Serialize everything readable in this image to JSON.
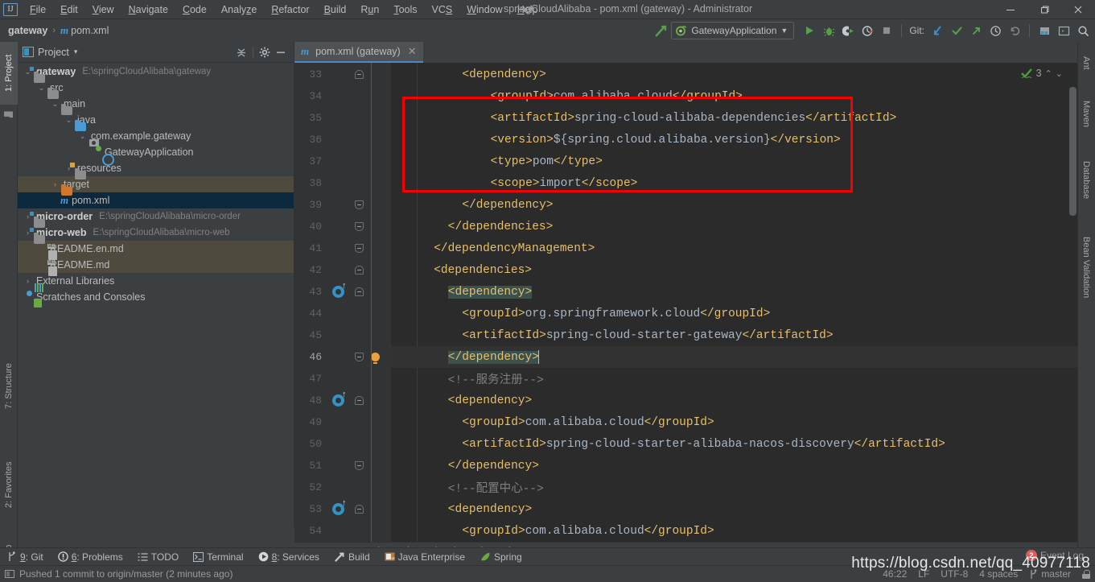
{
  "window": {
    "title": "springCloudAlibaba - pom.xml (gateway) - Administrator",
    "minimize": "—",
    "maximize": "❐",
    "close": "✕",
    "logo": "IJ"
  },
  "menu": {
    "items": [
      {
        "label": "File",
        "mnemonic": "F"
      },
      {
        "label": "Edit",
        "mnemonic": "E"
      },
      {
        "label": "View",
        "mnemonic": "V"
      },
      {
        "label": "Navigate",
        "mnemonic": "N"
      },
      {
        "label": "Code",
        "mnemonic": "C"
      },
      {
        "label": "Analyze",
        "mnemonic": "z"
      },
      {
        "label": "Refactor",
        "mnemonic": "R"
      },
      {
        "label": "Build",
        "mnemonic": "B"
      },
      {
        "label": "Run",
        "mnemonic": "u"
      },
      {
        "label": "Tools",
        "mnemonic": "T"
      },
      {
        "label": "VCS",
        "mnemonic": "S"
      },
      {
        "label": "Window",
        "mnemonic": "W"
      },
      {
        "label": "Help",
        "mnemonic": "H"
      }
    ]
  },
  "navbar": {
    "crumb_project": "gateway",
    "crumb_file": "pom.xml",
    "separator": "›",
    "maven_glyph": "m"
  },
  "toolbar": {
    "build_label": "build-hammer-icon",
    "run_config": "GatewayApplication",
    "run": "Run",
    "debug": "Debug",
    "run_coverage": "Run with Coverage",
    "profile": "Profile",
    "stop": "Stop",
    "git_label": "Git:",
    "update_project": "Update Project",
    "commit": "Commit",
    "push": "Push",
    "history": "History",
    "rollback": "Rollback",
    "search_everywhere": "Search Everywhere"
  },
  "left_tool_strip": [
    {
      "label": "1: Project",
      "mnemonic": "1",
      "active": true
    },
    {
      "label": "7: Structure",
      "mnemonic": "7",
      "active": false
    },
    {
      "label": "2: Favorites",
      "mnemonic": "2",
      "active": false
    },
    {
      "label": "Web",
      "mnemonic": "",
      "active": false
    }
  ],
  "right_tool_strip": [
    {
      "label": "Ant"
    },
    {
      "label": "Maven"
    },
    {
      "label": "Database"
    },
    {
      "label": "Bean Validation"
    }
  ],
  "project_panel": {
    "title": "Project",
    "dropdown": "▾",
    "collapse_all": "collapse-all-icon",
    "settings": "gear-icon",
    "hide": "hide-icon",
    "tree": [
      {
        "indent": 0,
        "arrow": "⌄",
        "icon": "module",
        "label": "gateway",
        "bold": true,
        "path": "E:\\springCloudAlibaba\\gateway",
        "state": "normal"
      },
      {
        "indent": 1,
        "arrow": "⌄",
        "icon": "folder",
        "label": "src",
        "bold": false,
        "path": "",
        "state": "normal"
      },
      {
        "indent": 2,
        "arrow": "⌄",
        "icon": "folder",
        "label": "main",
        "bold": false,
        "path": "",
        "state": "normal"
      },
      {
        "indent": 3,
        "arrow": "⌄",
        "icon": "source-folder",
        "label": "java",
        "bold": false,
        "path": "",
        "state": "normal"
      },
      {
        "indent": 4,
        "arrow": "⌄",
        "icon": "package",
        "label": "com.example.gateway",
        "bold": false,
        "path": "",
        "state": "normal"
      },
      {
        "indent": 5,
        "arrow": "",
        "icon": "spring-class",
        "label": "GatewayApplication",
        "bold": false,
        "path": "",
        "state": "normal"
      },
      {
        "indent": 3,
        "arrow": "›",
        "icon": "resources-folder",
        "label": "resources",
        "bold": false,
        "path": "",
        "state": "normal"
      },
      {
        "indent": 2,
        "arrow": "›",
        "icon": "target-folder",
        "label": "target",
        "bold": false,
        "path": "",
        "state": "highlighted"
      },
      {
        "indent": 2,
        "arrow": "",
        "icon": "maven-file",
        "label": "pom.xml",
        "bold": false,
        "path": "",
        "state": "selected"
      },
      {
        "indent": 0,
        "arrow": "›",
        "icon": "module",
        "label": "micro-order",
        "bold": true,
        "path": "E:\\springCloudAlibaba\\micro-order",
        "state": "normal"
      },
      {
        "indent": 0,
        "arrow": "›",
        "icon": "module",
        "label": "micro-web",
        "bold": true,
        "path": "E:\\springCloudAlibaba\\micro-web",
        "state": "normal"
      },
      {
        "indent": 1,
        "arrow": "",
        "icon": "markdown",
        "label": "README.en.md",
        "bold": false,
        "path": "",
        "state": "highlighted"
      },
      {
        "indent": 1,
        "arrow": "",
        "icon": "markdown",
        "label": "README.md",
        "bold": false,
        "path": "",
        "state": "highlighted"
      },
      {
        "indent": 0,
        "arrow": "›",
        "icon": "library",
        "label": "External Libraries",
        "bold": false,
        "path": "",
        "state": "normal"
      },
      {
        "indent": 0,
        "arrow": "",
        "icon": "scratch",
        "label": "Scratches and Consoles",
        "bold": false,
        "path": "",
        "state": "normal"
      }
    ]
  },
  "editor": {
    "tab": {
      "label": "pom.xml (gateway)",
      "close": "✕",
      "icon": "maven-file-icon"
    },
    "inspection": {
      "status_icon": "green-check",
      "count": "3",
      "prev": "⌃",
      "next": "⌄"
    },
    "breadcrumb": [
      "project",
      "dependencies",
      "dependency"
    ],
    "breadcrumb_sep": "›",
    "first_line": 33,
    "lines": [
      {
        "n": 33,
        "indent": 8,
        "gutter": "fold-start",
        "current": false,
        "spans": [
          {
            "t": "tag",
            "v": "<dependency>"
          }
        ]
      },
      {
        "n": 34,
        "indent": 12,
        "gutter": "",
        "current": false,
        "spans": [
          {
            "t": "tag",
            "v": "<groupId>"
          },
          {
            "t": "txt",
            "v": "com.alibaba.cloud"
          },
          {
            "t": "tag",
            "v": "</groupId>"
          }
        ]
      },
      {
        "n": 35,
        "indent": 12,
        "gutter": "",
        "current": false,
        "spans": [
          {
            "t": "tag",
            "v": "<artifactId>"
          },
          {
            "t": "txt",
            "v": "spring-cloud-alibaba-dependencies"
          },
          {
            "t": "tag",
            "v": "</artifactId>"
          }
        ]
      },
      {
        "n": 36,
        "indent": 12,
        "gutter": "",
        "current": false,
        "spans": [
          {
            "t": "tag",
            "v": "<version>"
          },
          {
            "t": "txt",
            "v": "${spring.cloud.alibaba.version}"
          },
          {
            "t": "tag",
            "v": "</version>"
          }
        ]
      },
      {
        "n": 37,
        "indent": 12,
        "gutter": "",
        "current": false,
        "spans": [
          {
            "t": "tag",
            "v": "<type>"
          },
          {
            "t": "txt",
            "v": "pom"
          },
          {
            "t": "tag",
            "v": "</type>"
          }
        ]
      },
      {
        "n": 38,
        "indent": 12,
        "gutter": "",
        "current": false,
        "spans": [
          {
            "t": "tag",
            "v": "<scope>"
          },
          {
            "t": "txt",
            "v": "import"
          },
          {
            "t": "tag",
            "v": "</scope>"
          }
        ]
      },
      {
        "n": 39,
        "indent": 8,
        "gutter": "fold-end",
        "current": false,
        "spans": [
          {
            "t": "tag",
            "v": "</dependency>"
          }
        ]
      },
      {
        "n": 40,
        "indent": 6,
        "gutter": "fold-end",
        "current": false,
        "spans": [
          {
            "t": "tag",
            "v": "</dependencies>"
          }
        ]
      },
      {
        "n": 41,
        "indent": 4,
        "gutter": "fold-end",
        "current": false,
        "spans": [
          {
            "t": "tag",
            "v": "</dependencyManagement>"
          }
        ]
      },
      {
        "n": 42,
        "indent": 4,
        "gutter": "fold-start",
        "current": false,
        "spans": [
          {
            "t": "tag",
            "v": "<dependencies>"
          }
        ]
      },
      {
        "n": 43,
        "indent": 6,
        "gutter": "maven-fold-start",
        "current": false,
        "spans": [
          {
            "t": "tag hl",
            "v": "<dependency>"
          }
        ]
      },
      {
        "n": 44,
        "indent": 8,
        "gutter": "",
        "current": false,
        "spans": [
          {
            "t": "tag",
            "v": "<groupId>"
          },
          {
            "t": "txt",
            "v": "org.springframework.cloud"
          },
          {
            "t": "tag",
            "v": "</groupId>"
          }
        ]
      },
      {
        "n": 45,
        "indent": 8,
        "gutter": "",
        "current": false,
        "spans": [
          {
            "t": "tag",
            "v": "<artifactId>"
          },
          {
            "t": "txt",
            "v": "spring-cloud-starter-gateway"
          },
          {
            "t": "tag",
            "v": "</artifactId>"
          }
        ]
      },
      {
        "n": 46,
        "indent": 6,
        "gutter": "bulb-fold-end",
        "current": true,
        "spans": [
          {
            "t": "tag hl",
            "v": "</dependency>"
          },
          {
            "t": "caret",
            "v": ""
          }
        ]
      },
      {
        "n": 47,
        "indent": 6,
        "gutter": "",
        "current": false,
        "spans": [
          {
            "t": "cmt",
            "v": "<!--服务注册-->"
          }
        ]
      },
      {
        "n": 48,
        "indent": 6,
        "gutter": "maven-fold-start",
        "current": false,
        "spans": [
          {
            "t": "tag",
            "v": "<dependency>"
          }
        ]
      },
      {
        "n": 49,
        "indent": 8,
        "gutter": "",
        "current": false,
        "spans": [
          {
            "t": "tag",
            "v": "<groupId>"
          },
          {
            "t": "txt",
            "v": "com.alibaba.cloud"
          },
          {
            "t": "tag",
            "v": "</groupId>"
          }
        ]
      },
      {
        "n": 50,
        "indent": 8,
        "gutter": "",
        "current": false,
        "spans": [
          {
            "t": "tag",
            "v": "<artifactId>"
          },
          {
            "t": "txt",
            "v": "spring-cloud-starter-alibaba-nacos-discovery"
          },
          {
            "t": "tag",
            "v": "</artifactId>"
          }
        ]
      },
      {
        "n": 51,
        "indent": 6,
        "gutter": "fold-end",
        "current": false,
        "spans": [
          {
            "t": "tag",
            "v": "</dependency>"
          }
        ]
      },
      {
        "n": 52,
        "indent": 6,
        "gutter": "",
        "current": false,
        "spans": [
          {
            "t": "cmt",
            "v": "<!--配置中心-->"
          }
        ]
      },
      {
        "n": 53,
        "indent": 6,
        "gutter": "maven-fold-start",
        "current": false,
        "spans": [
          {
            "t": "tag",
            "v": "<dependency>"
          }
        ]
      },
      {
        "n": 54,
        "indent": 8,
        "gutter": "",
        "current": false,
        "spans": [
          {
            "t": "tag",
            "v": "<groupId>"
          },
          {
            "t": "txt",
            "v": "com.alibaba.cloud"
          },
          {
            "t": "tag",
            "v": "</groupId>"
          }
        ]
      }
    ]
  },
  "bottom_tools": [
    {
      "label": "9: Git",
      "mnemonic": "9",
      "icon": "git-branch-icon"
    },
    {
      "label": "6: Problems",
      "mnemonic": "6",
      "icon": "problems-icon"
    },
    {
      "label": "TODO",
      "mnemonic": "",
      "icon": "todo-list-icon"
    },
    {
      "label": "Terminal",
      "mnemonic": "",
      "icon": "terminal-icon"
    },
    {
      "label": "8: Services",
      "mnemonic": "8",
      "icon": "services-play-icon"
    },
    {
      "label": "Build",
      "mnemonic": "",
      "icon": "build-hammer-icon"
    },
    {
      "label": "Java Enterprise",
      "mnemonic": "",
      "icon": "java-enterprise-icon"
    },
    {
      "label": "Spring",
      "mnemonic": "",
      "icon": "spring-leaf-icon"
    }
  ],
  "status_bar": {
    "message": "Pushed 1 commit to origin/master (2 minutes ago)",
    "message_icon": "console-icon",
    "caret_position": "46:22",
    "line_separator": "LF",
    "encoding": "UTF-8",
    "indent": "4 spaces",
    "branch": "master",
    "branch_icon": "git-branch-icon",
    "lock": "lock-icon"
  },
  "event_log": {
    "label": "Event Log",
    "badge": "2"
  },
  "watermark": "https://blog.csdn.net/qq_40977118",
  "colors": {
    "bg_chrome": "#3c3f41",
    "bg_editor": "#2b2b2b",
    "bg_gutter": "#313335",
    "accent_blue": "#4a88c7",
    "tag": "#e8bf6a",
    "text": "#a9b7c6",
    "comment": "#7f7f7f",
    "highlight_box": "#f40000",
    "selection": "#0d293e",
    "tag_match": "#3b514d"
  }
}
